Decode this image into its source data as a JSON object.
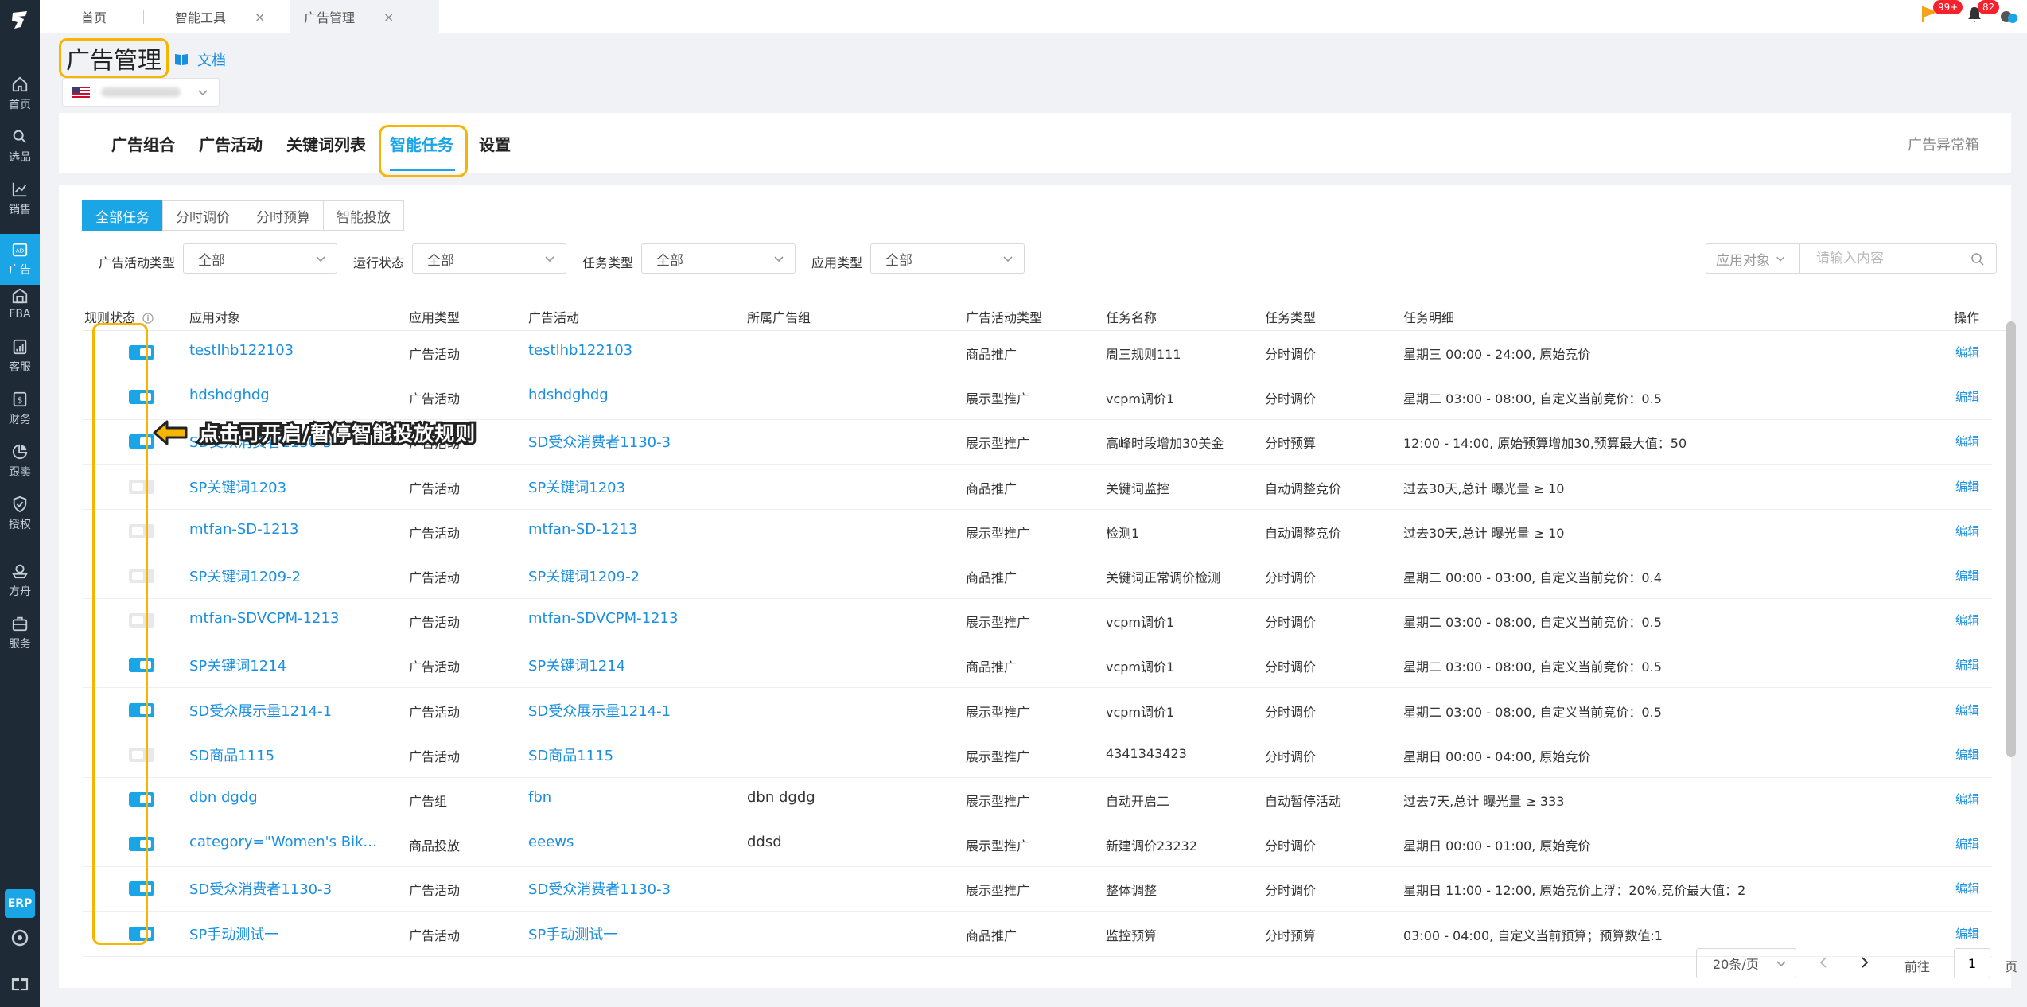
{
  "sidebar": {
    "items": [
      {
        "label": "首页",
        "icon": "home-icon"
      },
      {
        "label": "选品",
        "icon": "search-icon"
      },
      {
        "label": "销售",
        "icon": "chart-line-icon"
      },
      {
        "label": "广告",
        "icon": "ad-icon"
      },
      {
        "label": "FBA",
        "icon": "warehouse-icon"
      },
      {
        "label": "客服",
        "icon": "report-icon"
      },
      {
        "label": "财务",
        "icon": "dollar-icon"
      },
      {
        "label": "跟卖",
        "icon": "pie-chart-icon"
      },
      {
        "label": "授权",
        "icon": "shield-check-icon"
      },
      {
        "label": "方舟",
        "icon": "ark-icon"
      },
      {
        "label": "服务",
        "icon": "briefcase-icon"
      }
    ],
    "active_index": 3,
    "erp_label": "ERP"
  },
  "tabbar": {
    "tabs": [
      {
        "label": "首页",
        "closable": false
      },
      {
        "label": "智能工具",
        "closable": true
      },
      {
        "label": "广告管理",
        "closable": true,
        "active": true
      }
    ],
    "notifications": {
      "flag_badge": "99+",
      "bell_badge": "82"
    }
  },
  "header": {
    "title": "广告管理",
    "doc_link": "文档"
  },
  "main_tabs": {
    "items": [
      "广告组合",
      "广告活动",
      "关键词列表",
      "智能任务",
      "设置"
    ],
    "active_index": 3,
    "right_link": "广告异常箱"
  },
  "sub_tabs": {
    "items": [
      "全部任务",
      "分时调价",
      "分时预算",
      "智能投放"
    ],
    "active_index": 0
  },
  "filters": [
    {
      "label": "广告活动类型",
      "value": "全部"
    },
    {
      "label": "运行状态",
      "value": "全部"
    },
    {
      "label": "任务类型",
      "value": "全部"
    },
    {
      "label": "应用类型",
      "value": "全部"
    }
  ],
  "search": {
    "scope": "应用对象",
    "placeholder": "请输入内容"
  },
  "table": {
    "columns": [
      "规则状态",
      "应用对象",
      "应用类型",
      "广告活动",
      "所属广告组",
      "广告活动类型",
      "任务名称",
      "任务类型",
      "任务明细",
      "操作"
    ],
    "rows": [
      {
        "on": true,
        "target": "testlhb122103",
        "apply_type": "广告活动",
        "campaign": "testlhb122103",
        "ad_group": "",
        "campaign_type": "商品推广",
        "task_name": "周三规则111",
        "task_type": "分时调价",
        "detail": "星期三 00:00 - 24:00, 原始竞价",
        "op": "编辑"
      },
      {
        "on": true,
        "target": "hdshdghdg",
        "apply_type": "广告活动",
        "campaign": "hdshdghdg",
        "ad_group": "",
        "campaign_type": "展示型推广",
        "task_name": "vcpm调价1",
        "task_type": "分时调价",
        "detail": "星期二 03:00 - 08:00, 自定义当前竞价：0.5",
        "op": "编辑"
      },
      {
        "on": true,
        "target": "SD受众消费者1130-3",
        "apply_type": "广告活动",
        "campaign": "SD受众消费者1130-3",
        "ad_group": "",
        "campaign_type": "展示型推广",
        "task_name": "高峰时段增加30美金",
        "task_type": "分时预算",
        "detail": "12:00 - 14:00, 原始预算增加30,预算最大值：50",
        "op": "编辑"
      },
      {
        "on": false,
        "target": "SP关键词1203",
        "apply_type": "广告活动",
        "campaign": "SP关键词1203",
        "ad_group": "",
        "campaign_type": "商品推广",
        "task_name": "关键词监控",
        "task_type": "自动调整竞价",
        "detail": "过去30天,总计 曝光量 ≥ 10",
        "op": "编辑"
      },
      {
        "on": false,
        "target": "mtfan-SD-1213",
        "apply_type": "广告活动",
        "campaign": "mtfan-SD-1213",
        "ad_group": "",
        "campaign_type": "展示型推广",
        "task_name": "检测1",
        "task_type": "自动调整竞价",
        "detail": "过去30天,总计 曝光量 ≥ 10",
        "op": "编辑"
      },
      {
        "on": false,
        "target": "SP关键词1209-2",
        "apply_type": "广告活动",
        "campaign": "SP关键词1209-2",
        "ad_group": "",
        "campaign_type": "商品推广",
        "task_name": "关键词正常调价检测",
        "task_type": "分时调价",
        "detail": "星期二 00:00 - 03:00, 自定义当前竞价：0.4",
        "op": "编辑"
      },
      {
        "on": false,
        "target": "mtfan-SDVCPM-1213",
        "apply_type": "广告活动",
        "campaign": "mtfan-SDVCPM-1213",
        "ad_group": "",
        "campaign_type": "展示型推广",
        "task_name": "vcpm调价1",
        "task_type": "分时调价",
        "detail": "星期二 03:00 - 08:00, 自定义当前竞价：0.5",
        "op": "编辑"
      },
      {
        "on": true,
        "target": "SP关键词1214",
        "apply_type": "广告活动",
        "campaign": "SP关键词1214",
        "ad_group": "",
        "campaign_type": "商品推广",
        "task_name": "vcpm调价1",
        "task_type": "分时调价",
        "detail": "星期二 03:00 - 08:00, 自定义当前竞价：0.5",
        "op": "编辑"
      },
      {
        "on": true,
        "target": "SD受众展示量1214-1",
        "apply_type": "广告活动",
        "campaign": "SD受众展示量1214-1",
        "ad_group": "",
        "campaign_type": "展示型推广",
        "task_name": "vcpm调价1",
        "task_type": "分时调价",
        "detail": "星期二 03:00 - 08:00, 自定义当前竞价：0.5",
        "op": "编辑"
      },
      {
        "on": false,
        "target": "SD商品1115",
        "apply_type": "广告活动",
        "campaign": "SD商品1115",
        "ad_group": "",
        "campaign_type": "展示型推广",
        "task_name": "4341343423",
        "task_type": "分时调价",
        "detail": "星期日 00:00 - 04:00, 原始竞价",
        "op": "编辑"
      },
      {
        "on": true,
        "target": "dbn dgdg",
        "apply_type": "广告组",
        "campaign": "fbn",
        "ad_group": "dbn dgdg",
        "campaign_type": "展示型推广",
        "task_name": "自动开启二",
        "task_type": "自动暂停活动",
        "detail": "过去7天,总计 曝光量 ≥ 333",
        "op": "编辑"
      },
      {
        "on": true,
        "target": "category=\"Women's Bik...",
        "apply_type": "商品投放",
        "campaign": "eeews",
        "ad_group": "ddsd",
        "campaign_type": "展示型推广",
        "task_name": "新建调价23232",
        "task_type": "分时调价",
        "detail": "星期日 00:00 - 01:00, 原始竞价",
        "op": "编辑"
      },
      {
        "on": true,
        "target": "SD受众消费者1130-3",
        "apply_type": "广告活动",
        "campaign": "SD受众消费者1130-3",
        "ad_group": "",
        "campaign_type": "展示型推广",
        "task_name": "整体调整",
        "task_type": "分时调价",
        "detail": "星期日 11:00 - 12:00, 原始竞价上浮：20%,竞价最大值：2",
        "op": "编辑"
      },
      {
        "on": true,
        "target": "SP手动测试一",
        "apply_type": "广告活动",
        "campaign": "SP手动测试一",
        "ad_group": "",
        "campaign_type": "商品推广",
        "task_name": "监控预算",
        "task_type": "分时预算",
        "detail": "03:00 - 04:00, 自定义当前预算；预算数值:1",
        "op": "编辑"
      }
    ]
  },
  "callout": {
    "text": "点击可开启/暂停智能投放规则"
  },
  "pagination": {
    "page_size": "20条/页",
    "goto_label": "前往",
    "goto_value": "1",
    "goto_suffix": "页"
  },
  "colors": {
    "accent": "#1aa5e6",
    "highlight": "#f7b500",
    "sidebar": "#1e2a36"
  }
}
